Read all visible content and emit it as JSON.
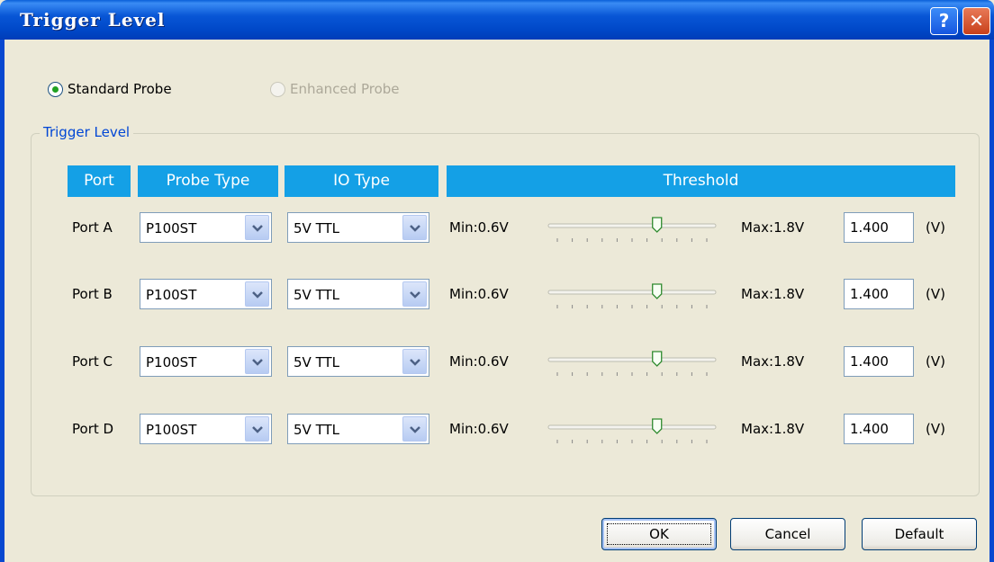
{
  "window": {
    "title": "Trigger Level",
    "help_label": "?",
    "close_label": "✕"
  },
  "probe_mode": {
    "standard_label": "Standard Probe",
    "enhanced_label": "Enhanced Probe",
    "selected": "standard"
  },
  "group": {
    "label": "Trigger Level"
  },
  "table": {
    "headers": [
      "Port",
      "Probe Type",
      "IO Type",
      "Threshold"
    ],
    "rows": [
      {
        "port": "Port A",
        "probe_type": "P100ST",
        "io_type": "5V TTL",
        "min": "Min:0.6V",
        "max": "Max:1.8V",
        "value": "1.400",
        "unit": "(V)"
      },
      {
        "port": "Port B",
        "probe_type": "P100ST",
        "io_type": "5V TTL",
        "min": "Min:0.6V",
        "max": "Max:1.8V",
        "value": "1.400",
        "unit": "(V)"
      },
      {
        "port": "Port C",
        "probe_type": "P100ST",
        "io_type": "5V TTL",
        "min": "Min:0.6V",
        "max": "Max:1.8V",
        "value": "1.400",
        "unit": "(V)"
      },
      {
        "port": "Port D",
        "probe_type": "P100ST",
        "io_type": "5V TTL",
        "min": "Min:0.6V",
        "max": "Max:1.8V",
        "value": "1.400",
        "unit": "(V)"
      }
    ],
    "slider_level": 0.667
  },
  "buttons": {
    "ok": "OK",
    "cancel": "Cancel",
    "default": "Default"
  },
  "colors": {
    "header_bg": "#14a0e6",
    "title_bar": "#0054e3",
    "group_label": "#0046d5"
  }
}
